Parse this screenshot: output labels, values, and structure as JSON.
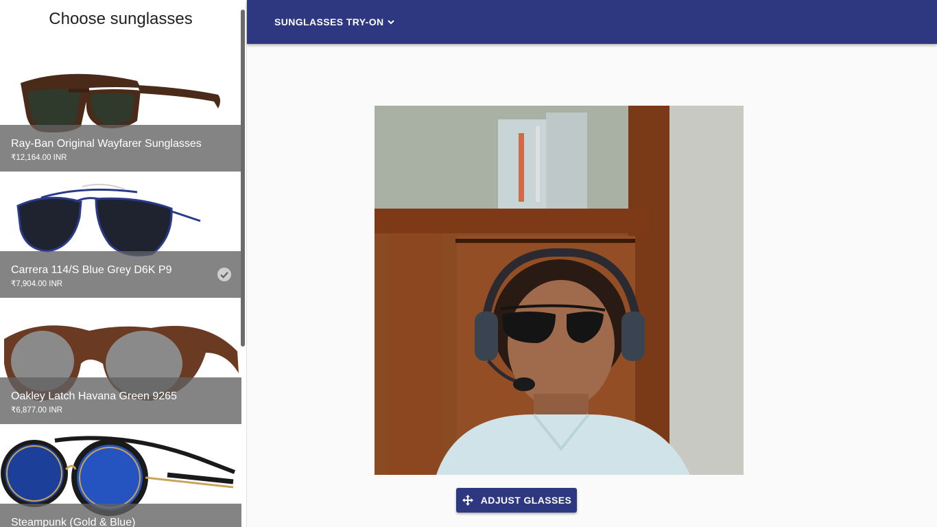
{
  "sidebar": {
    "title": "Choose sunglasses",
    "items": [
      {
        "name": "Ray-Ban Original Wayfarer Sunglasses",
        "price": "₹12,164.00 INR",
        "selected": false
      },
      {
        "name": "Carrera 114/S Blue Grey D6K P9",
        "price": "₹7,904.00 INR",
        "selected": true
      },
      {
        "name": "Oakley Latch Havana Green 9265",
        "price": "₹6,877.00 INR",
        "selected": false
      },
      {
        "name": "Steampunk (Gold & Blue)",
        "price": "",
        "selected": false
      }
    ]
  },
  "appbar": {
    "menu_label": "SUNGLASSES TRY-ON",
    "menu_icon": "chevron-down-icon"
  },
  "main": {
    "adjust_button_label": "ADJUST GLASSES",
    "adjust_icon": "move-arrows-icon"
  },
  "colors": {
    "primary": "#2e3880",
    "tile_overlay": "#616161"
  }
}
